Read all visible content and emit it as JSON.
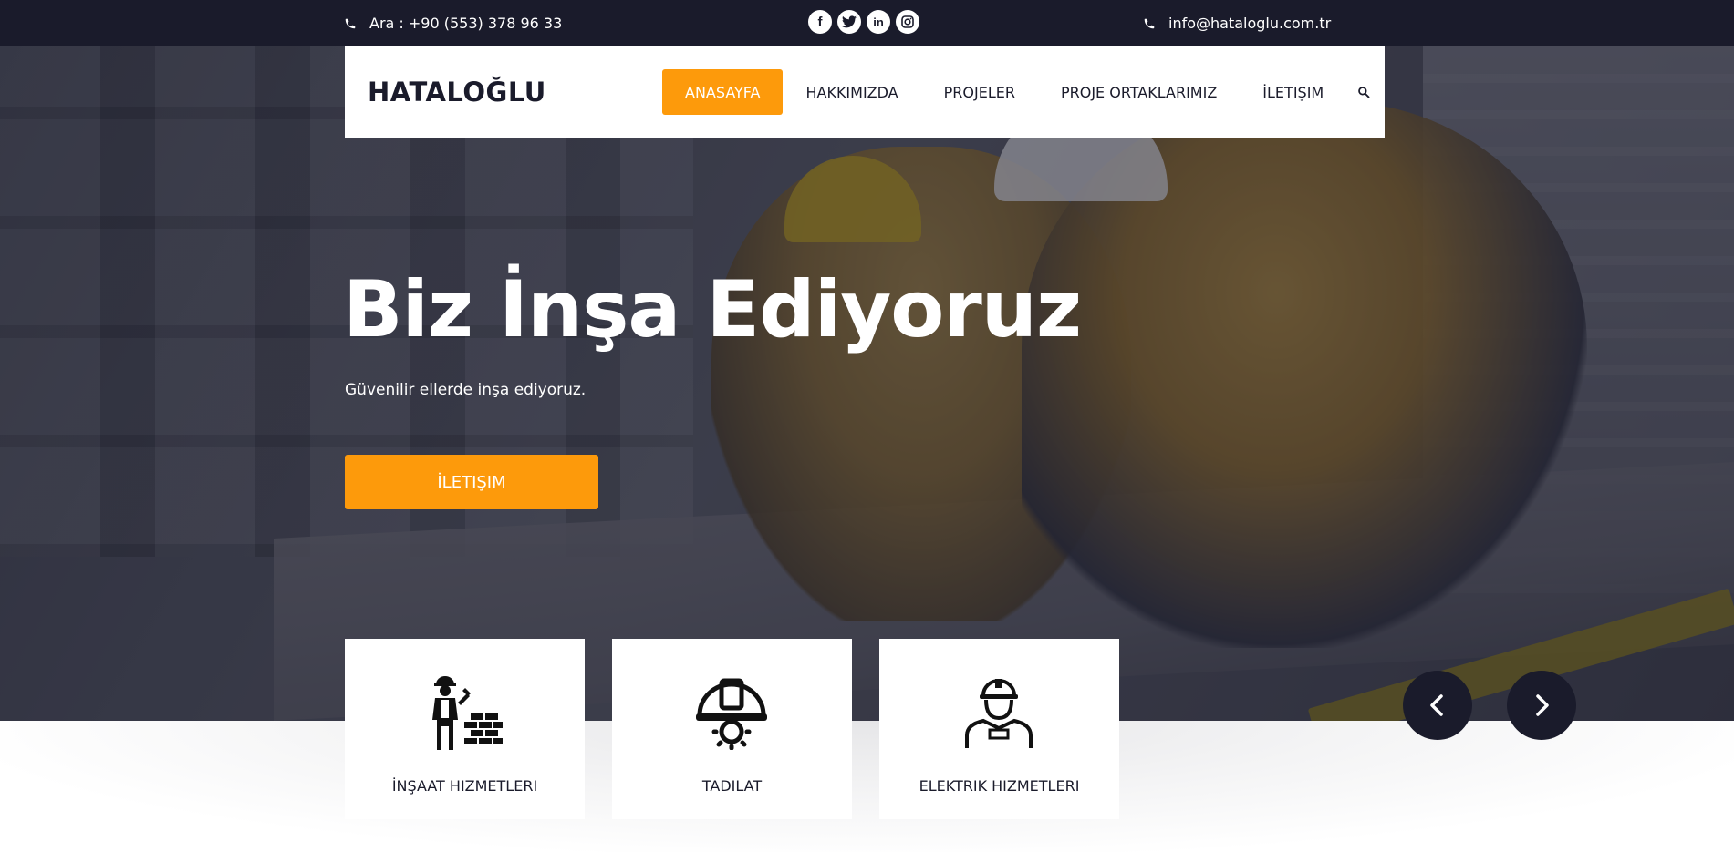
{
  "topbar": {
    "phone": "Ara : +90 (553) 378 96 33",
    "email": "info@hataloglu.com.tr",
    "social": [
      {
        "icon": "facebook-icon",
        "glyph": "f"
      },
      {
        "icon": "twitter-icon",
        "glyph": "t"
      },
      {
        "icon": "linkedin-icon",
        "glyph": "in"
      },
      {
        "icon": "instagram-icon",
        "glyph": "◎"
      }
    ]
  },
  "brand": {
    "logo": "HATALOĞLU"
  },
  "nav": {
    "items": [
      "ANASAYFA",
      "HAKKIMIZDA",
      "PROJELER",
      "PROJE ORTAKLARIMIZ",
      "İLETIŞIM"
    ],
    "active_index": 0
  },
  "hero": {
    "title": "Biz İnşa Ediyoruz",
    "subtitle": "Güvenilir ellerde inşa ediyoruz.",
    "button": "İLETIŞIM"
  },
  "services": [
    {
      "label": "İNŞAAT HIZMETLERI",
      "icon": "construction-worker-icon"
    },
    {
      "label": "TADILAT",
      "icon": "helmet-gear-icon"
    },
    {
      "label": "ELEKTRIK HIZMETLERI",
      "icon": "engineer-icon"
    }
  ],
  "colors": {
    "accent": "#fd9a0b",
    "dark": "#1a1b2b",
    "white": "#ffffff"
  }
}
